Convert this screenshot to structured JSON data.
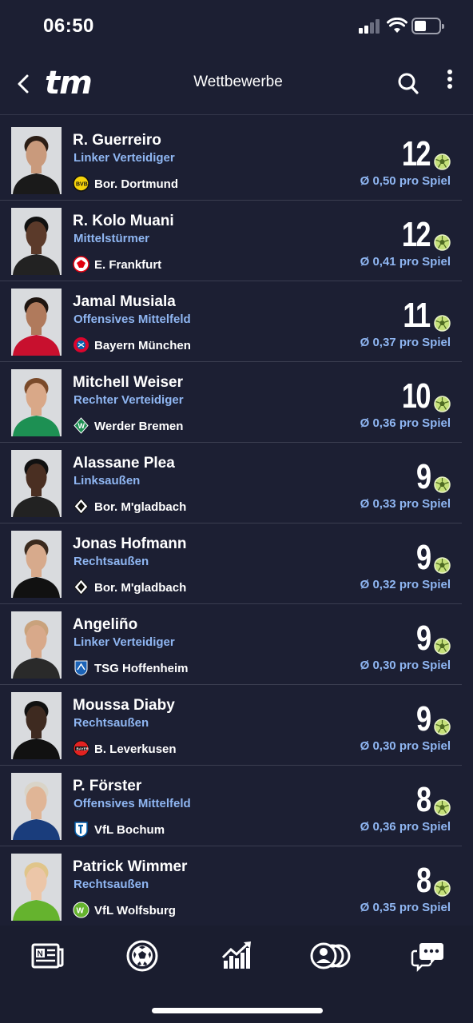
{
  "status_bar": {
    "time": "06:50"
  },
  "header": {
    "title": "Wettbewerbe",
    "logo": "tm"
  },
  "players": [
    {
      "name": "R. Guerreiro",
      "position": "Linker Verteidiger",
      "club": "Bor. Dortmund",
      "club_icon": "bvb-crest-icon",
      "goals": "12",
      "avg": "Ø 0,50 pro Spiel"
    },
    {
      "name": "R. Kolo Muani",
      "position": "Mittelstürmer",
      "club": "E. Frankfurt",
      "club_icon": "eintracht-crest-icon",
      "goals": "12",
      "avg": "Ø 0,41 pro Spiel"
    },
    {
      "name": "Jamal Musiala",
      "position": "Offensives Mittelfeld",
      "club": "Bayern München",
      "club_icon": "bayern-crest-icon",
      "goals": "11",
      "avg": "Ø 0,37 pro Spiel"
    },
    {
      "name": "Mitchell Weiser",
      "position": "Rechter Verteidiger",
      "club": "Werder Bremen",
      "club_icon": "werder-crest-icon",
      "goals": "10",
      "avg": "Ø 0,36 pro Spiel"
    },
    {
      "name": "Alassane Plea",
      "position": "Linksaußen",
      "club": "Bor. M'gladbach",
      "club_icon": "gladbach-crest-icon",
      "goals": "9",
      "avg": "Ø 0,33 pro Spiel"
    },
    {
      "name": "Jonas Hofmann",
      "position": "Rechtsaußen",
      "club": "Bor. M'gladbach",
      "club_icon": "gladbach-crest-icon",
      "goals": "9",
      "avg": "Ø 0,32 pro Spiel"
    },
    {
      "name": "Angeliño",
      "position": "Linker Verteidiger",
      "club": "TSG Hoffenheim",
      "club_icon": "hoffenheim-crest-icon",
      "goals": "9",
      "avg": "Ø 0,30 pro Spiel"
    },
    {
      "name": "Moussa Diaby",
      "position": "Rechtsaußen",
      "club": "B. Leverkusen",
      "club_icon": "leverkusen-crest-icon",
      "goals": "9",
      "avg": "Ø 0,30 pro Spiel"
    },
    {
      "name": "P. Förster",
      "position": "Offensives Mittelfeld",
      "club": "VfL Bochum",
      "club_icon": "bochum-crest-icon",
      "goals": "8",
      "avg": "Ø 0,36 pro Spiel"
    },
    {
      "name": "Patrick Wimmer",
      "position": "Rechtsaußen",
      "club": "VfL Wolfsburg",
      "club_icon": "wolfsburg-crest-icon",
      "goals": "8",
      "avg": "Ø 0,35 pro Spiel"
    }
  ],
  "bottom_nav": [
    {
      "icon": "news-icon"
    },
    {
      "icon": "football-icon"
    },
    {
      "icon": "market-chart-icon"
    },
    {
      "icon": "community-icon"
    },
    {
      "icon": "chat-icon"
    }
  ],
  "colors": {
    "background": "#1c1f33",
    "accent_text": "#8fb6f2",
    "ball": "#c5e07a"
  }
}
